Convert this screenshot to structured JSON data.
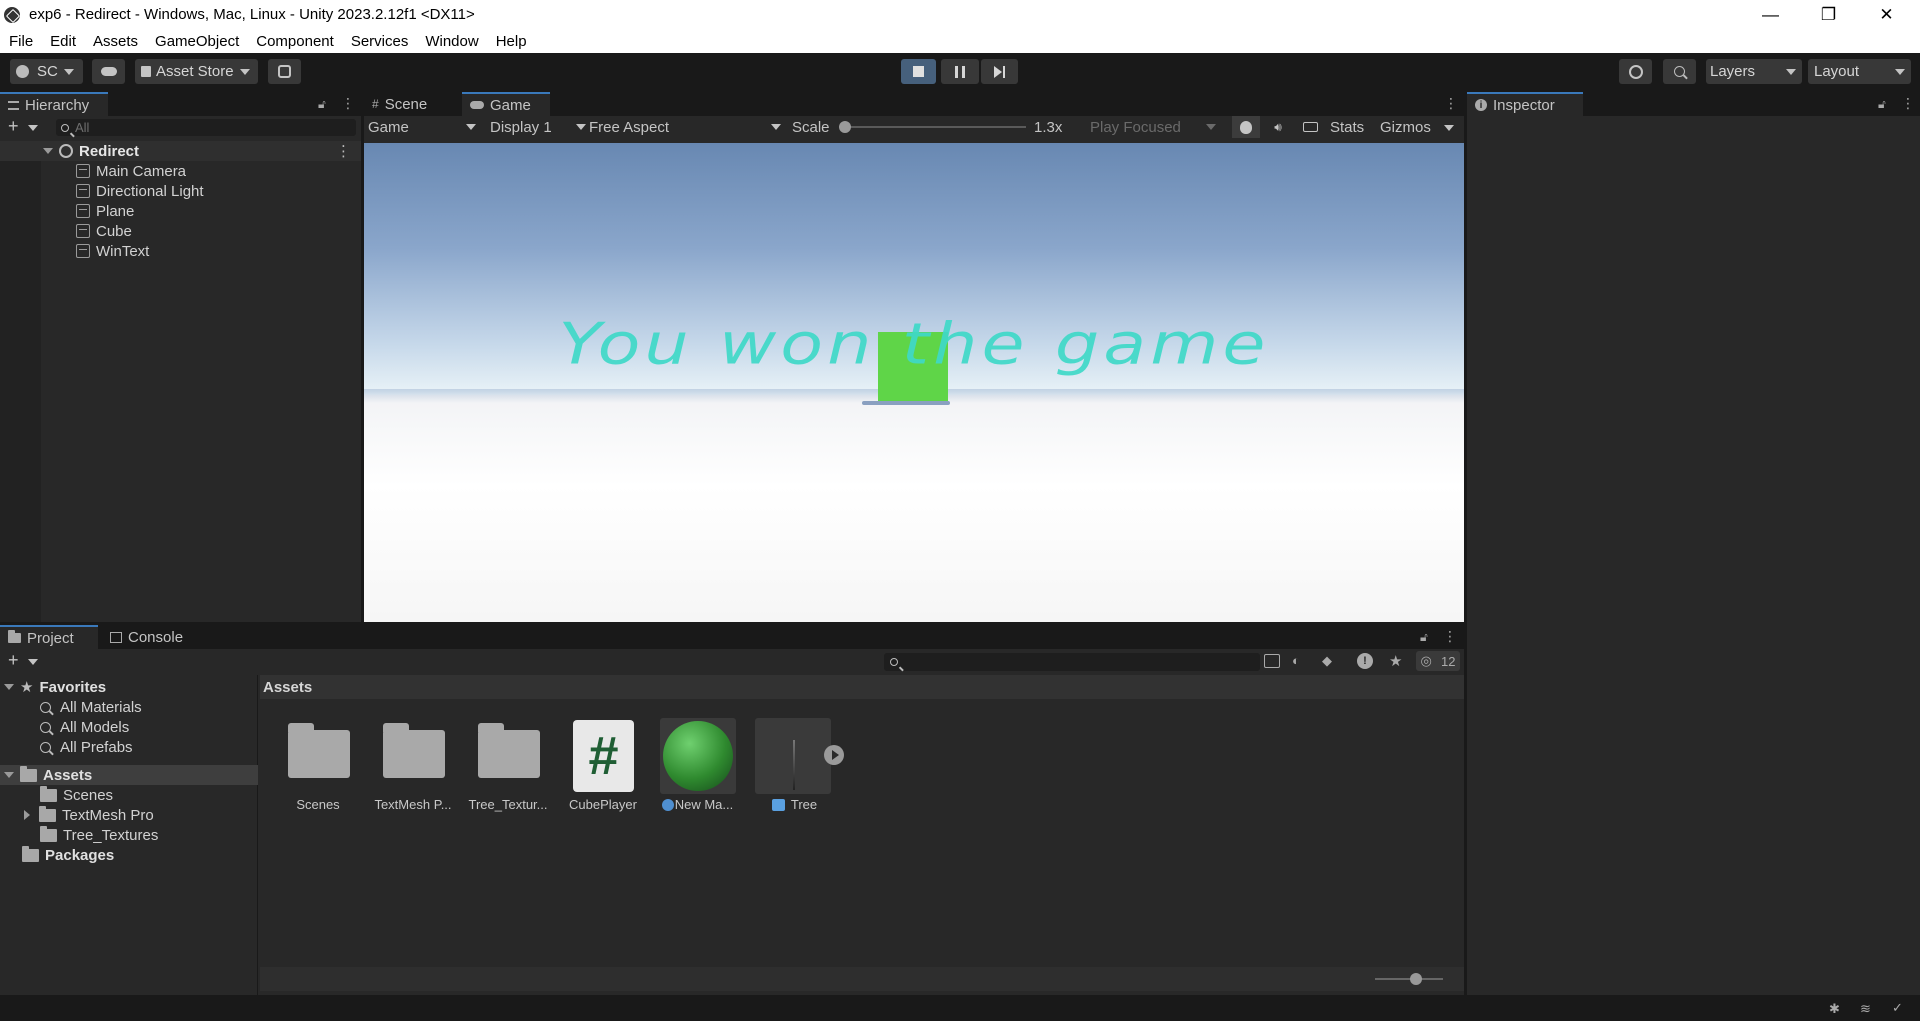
{
  "window": {
    "title": "exp6 - Redirect - Windows, Mac, Linux - Unity 2023.2.12f1 <DX11>",
    "minimize_glyph": "—",
    "maximize_glyph": "❐",
    "close_glyph": "✕"
  },
  "menu": [
    "File",
    "Edit",
    "Assets",
    "GameObject",
    "Component",
    "Services",
    "Window",
    "Help"
  ],
  "toolbar": {
    "account_label": "SC",
    "asset_store_label": "Asset Store",
    "layers_label": "Layers",
    "layout_label": "Layout"
  },
  "hierarchy": {
    "tab_label": "Hierarchy",
    "search_placeholder": "All",
    "scene_name": "Redirect",
    "objects": [
      "Main Camera",
      "Directional Light",
      "Plane",
      "Cube",
      "WinText"
    ]
  },
  "game_view": {
    "tabs": [
      "Scene",
      "Game"
    ],
    "mode_label": "Game",
    "display_label": "Display 1",
    "aspect_label": "Free Aspect",
    "scale_label": "Scale",
    "scale_value": "1.3x",
    "play_focused_label": "Play Focused",
    "stats_label": "Stats",
    "gizmos_label": "Gizmos",
    "win_text": "You won the game"
  },
  "inspector": {
    "tab_label": "Inspector"
  },
  "project": {
    "tabs": [
      "Project",
      "Console"
    ],
    "favorites_label": "Favorites",
    "favorites": [
      "All Materials",
      "All Models",
      "All Prefabs"
    ],
    "assets_label": "Assets",
    "asset_folders": [
      "Scenes",
      "TextMesh Pro",
      "Tree_Textures"
    ],
    "packages_label": "Packages",
    "breadcrumb": "Assets",
    "hidden_count": "12",
    "grid_items": [
      "Scenes",
      "TextMesh P...",
      "Tree_Textur...",
      "CubePlayer",
      "New Ma...",
      "Tree"
    ],
    "script_glyph": "#"
  },
  "colors": {
    "accent": "#3a79bb",
    "win_text": "#3fd9c8",
    "cube": "#5fd548",
    "sphere": "#2f8a2f"
  }
}
